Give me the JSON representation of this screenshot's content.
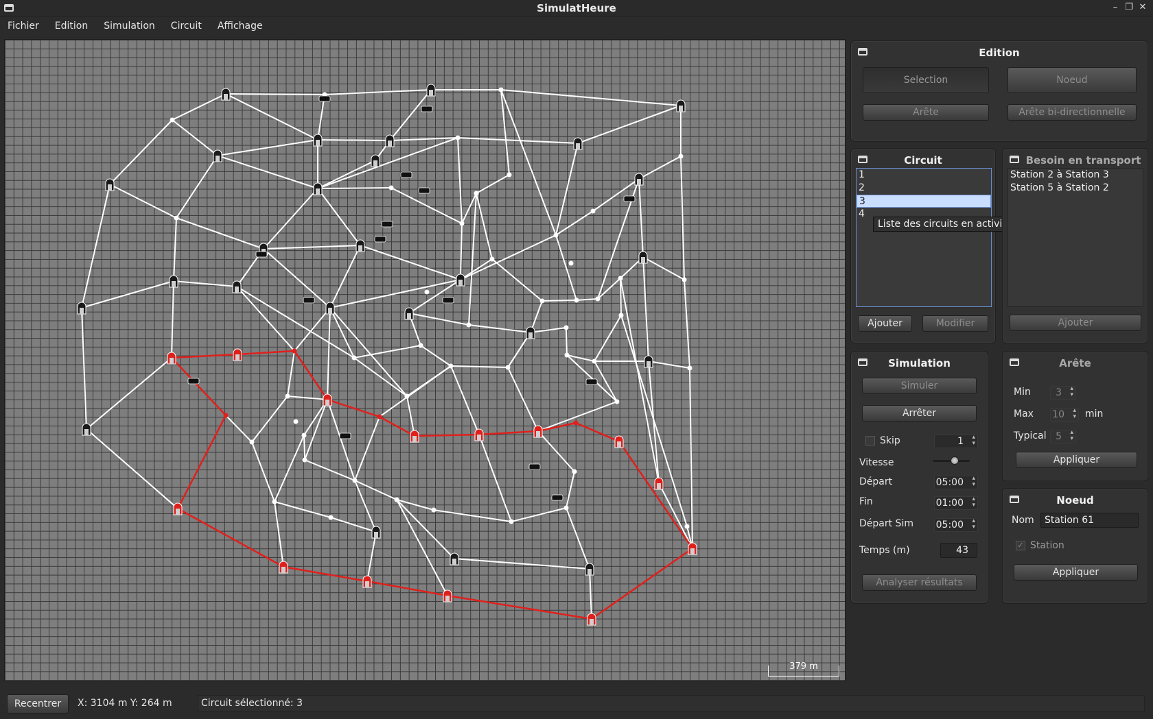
{
  "window": {
    "title": "SimulatHeure"
  },
  "menu": [
    "Fichier",
    "Edition",
    "Simulation",
    "Circuit",
    "Affichage"
  ],
  "map": {
    "scale_label": "379 m",
    "colors": {
      "background": "#7e7e7e",
      "grid": "#3a3a3a",
      "edge": "#ffffff",
      "selected_circuit": "#e0201c",
      "station": "#1a1a1a"
    }
  },
  "edition": {
    "title": "Edition",
    "buttons": {
      "selection": "Selection",
      "noeud": "Noeud",
      "arete": "Arête",
      "arete_bidir": "Arête bi-directionnelle"
    }
  },
  "circuit": {
    "title": "Circuit",
    "items": [
      "1",
      "2",
      "3",
      "4"
    ],
    "selected": "3",
    "tooltip": "Liste des circuits en activité",
    "add": "Ajouter",
    "modify": "Modifier"
  },
  "besoin": {
    "title": "Besoin en transport",
    "items": [
      "Station 2 à Station 3",
      "Station 5 à Station 2"
    ],
    "add": "Ajouter"
  },
  "simulation": {
    "title": "Simulation",
    "simuler": "Simuler",
    "arreter": "Arrêter",
    "skip_label": "Skip",
    "skip_value": "1",
    "vitesse_label": "Vitesse",
    "vitesse_level": 0.6,
    "depart_label": "Départ",
    "depart_value": "05:00",
    "fin_label": "Fin",
    "fin_value": "01:00",
    "depart_sim_label": "Départ Sim",
    "depart_sim_value": "05:00",
    "temps_label": "Temps (m)",
    "temps_value": "43",
    "analyser": "Analyser résultats"
  },
  "arete": {
    "title": "Arête",
    "min_label": "Min",
    "min_value": "3",
    "max_label": "Max",
    "max_value": "10",
    "max_unit": "min",
    "typical_label": "Typical",
    "typical_value": "5",
    "apply": "Appliquer"
  },
  "noeud": {
    "title": "Noeud",
    "nom_label": "Nom",
    "nom_value": "Station 61",
    "station_label": "Station",
    "apply": "Appliquer"
  },
  "status": {
    "recentrer": "Recentrer",
    "coords": "X:  3104 m   Y:  264 m",
    "message": "Circuit sélectionné: 3"
  }
}
